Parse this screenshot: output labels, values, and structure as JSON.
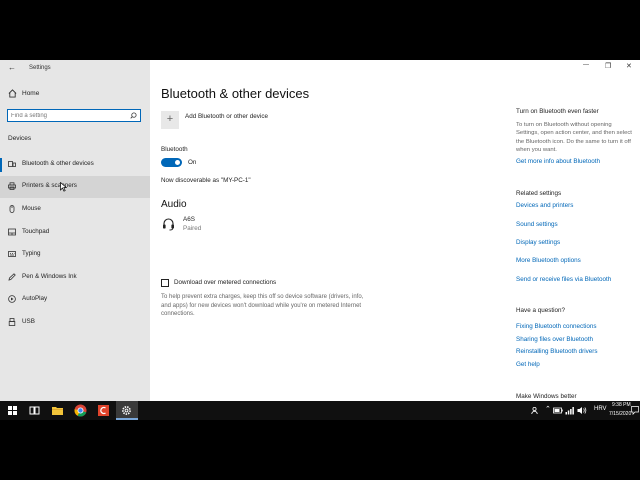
{
  "window": {
    "title": "Settings",
    "controls": {
      "minimize": "—",
      "restore": "❐",
      "close": "✕"
    }
  },
  "sidebar": {
    "home_label": "Home",
    "search_placeholder": "Find a setting",
    "section_title": "Devices",
    "items": [
      {
        "label": "Bluetooth & other devices",
        "icon": "bluetooth-icon"
      },
      {
        "label": "Printers & scanners",
        "icon": "printer-icon"
      },
      {
        "label": "Mouse",
        "icon": "mouse-icon"
      },
      {
        "label": "Touchpad",
        "icon": "touchpad-icon"
      },
      {
        "label": "Typing",
        "icon": "keyboard-icon"
      },
      {
        "label": "Pen & Windows Ink",
        "icon": "pen-icon"
      },
      {
        "label": "AutoPlay",
        "icon": "autoplay-icon"
      },
      {
        "label": "USB",
        "icon": "usb-icon"
      }
    ]
  },
  "main": {
    "page_title": "Bluetooth & other devices",
    "add_device_label": "Add Bluetooth or other device",
    "bluetooth_label": "Bluetooth",
    "bluetooth_state": "On",
    "discoverable_text": "Now discoverable as \"MY-PC-1\"",
    "audio_heading": "Audio",
    "audio_device_name": "A6S",
    "audio_device_status": "Paired",
    "metered_checkbox_label": "Download over metered connections",
    "metered_description": "To help prevent extra charges, keep this off so device software (drivers, info, and apps) for new devices won't download while you're on metered Internet connections."
  },
  "right": {
    "turn_on_heading": "Turn on Bluetooth even faster",
    "turn_on_text": "To turn on Bluetooth without opening Settings, open action center, and then select the Bluetooth icon. Do the same to turn it off when you want.",
    "more_info_link": "Get more info about Bluetooth",
    "related_heading": "Related settings",
    "related_links": [
      "Devices and printers",
      "Sound settings",
      "Display settings",
      "More Bluetooth options",
      "Send or receive files via Bluetooth"
    ],
    "question_heading": "Have a question?",
    "question_links": [
      "Fixing Bluetooth connections",
      "Sharing files over Bluetooth",
      "Reinstalling Bluetooth drivers",
      "Get help"
    ],
    "better_heading": "Make Windows better"
  },
  "taskbar": {
    "language": "HRV",
    "time": "9:38 PM",
    "date": "7/15/2020"
  },
  "colors": {
    "accent": "#0067b8",
    "sidebar_bg": "#e6e6e6",
    "taskbar_bg": "#101010"
  }
}
